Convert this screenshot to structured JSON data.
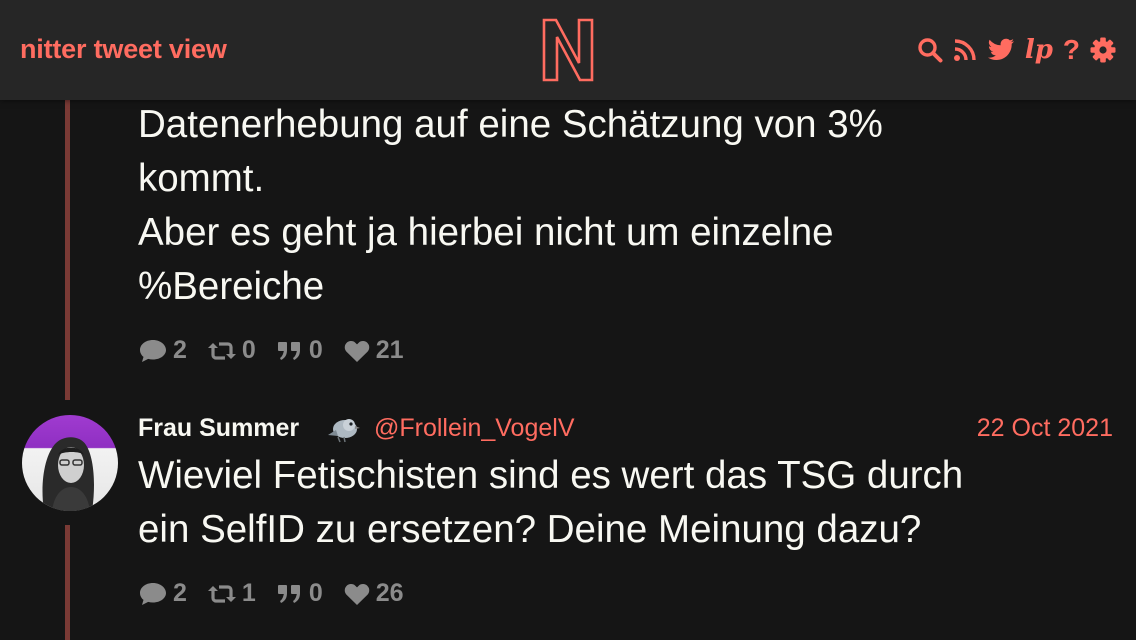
{
  "navbar": {
    "brand": "nitter tweet view",
    "logo_letter": "N",
    "icons": [
      "search-icon",
      "rss-icon",
      "twitter-bird-icon",
      "liberapay-icon",
      "help-icon",
      "gear-icon"
    ],
    "lp_label": "lp",
    "help_label": "?"
  },
  "colors": {
    "accent": "#ff6c60",
    "background": "#151515",
    "navbar": "#262626",
    "thread_line": "#7a3a35",
    "text": "#f8f8f2",
    "stat_text": "#8b8b8b"
  },
  "tweets": [
    {
      "text": "Datenerhebung auf eine Schätzung von 3%\nkommt.\nAber es geht ja hierbei nicht um einzelne\n%Bereiche",
      "stats": {
        "replies": "2",
        "retweets": "0",
        "quotes": "0",
        "likes": "21"
      }
    },
    {
      "fullname": "Frau Summer",
      "username": "@Frollein_VogelV",
      "date": "22 Oct 2021",
      "text": "Wieviel Fetischisten sind es wert das TSG durch\nein SelfID zu ersetzen? Deine Meinung dazu?",
      "stats": {
        "replies": "2",
        "retweets": "1",
        "quotes": "0",
        "likes": "26"
      }
    }
  ]
}
